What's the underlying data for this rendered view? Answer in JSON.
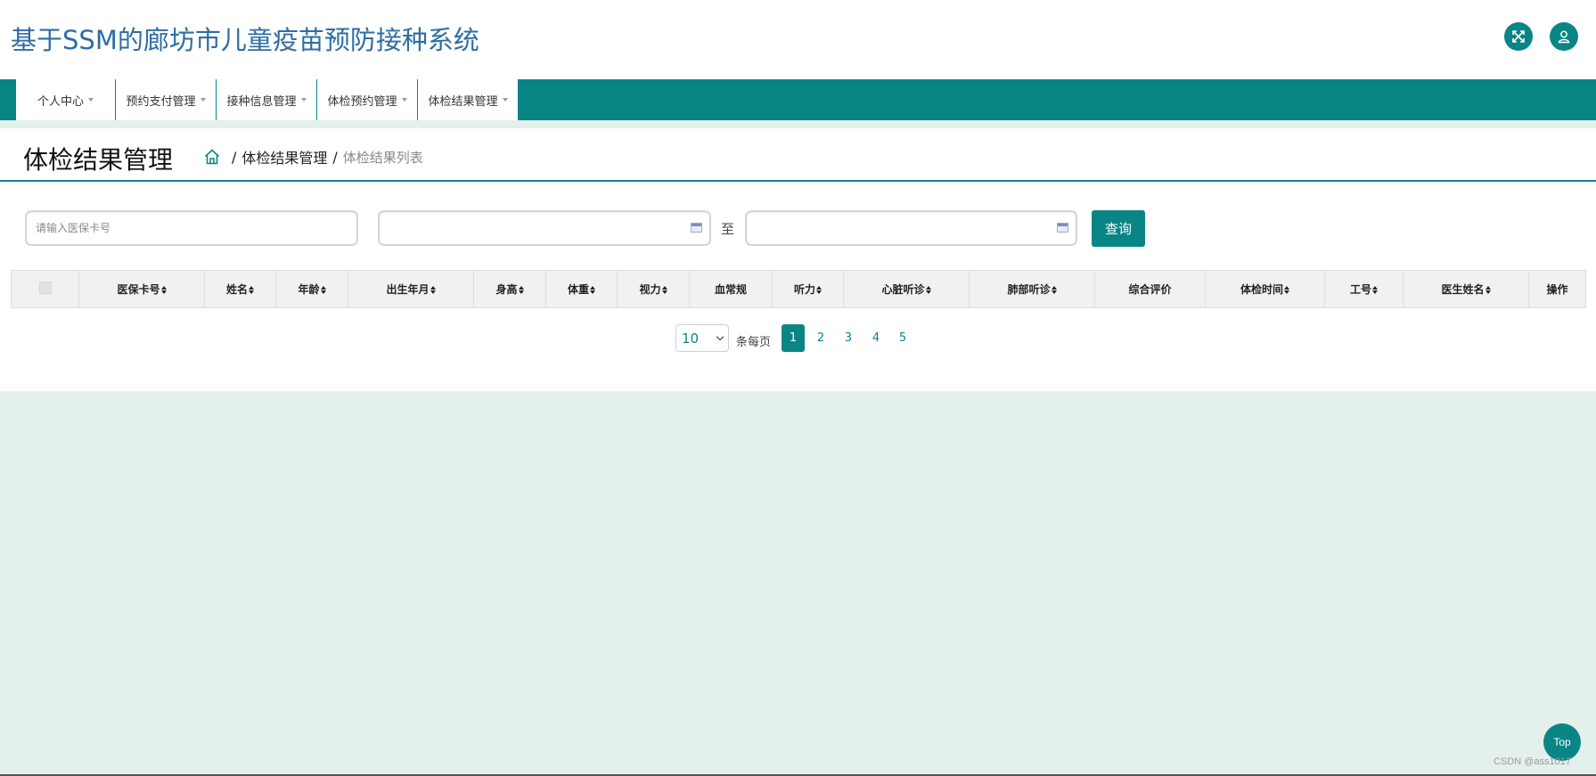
{
  "header": {
    "title": "基于SSM的廊坊市儿童疫苗预防接种系统",
    "fullscreen_icon": "fullscreen-icon",
    "user_icon": "user-icon"
  },
  "nav": {
    "items": [
      {
        "label": "个人中心"
      },
      {
        "label": "预约支付管理"
      },
      {
        "label": "接种信息管理"
      },
      {
        "label": "体检预约管理"
      },
      {
        "label": "体检结果管理"
      }
    ]
  },
  "page": {
    "title": "体检结果管理",
    "breadcrumb": {
      "sep": "/",
      "section": "体检结果管理",
      "current": "体检结果列表"
    }
  },
  "search": {
    "card_placeholder": "请输入医保卡号",
    "date_from": "",
    "date_to": "",
    "to_label": "至",
    "button_label": "查询"
  },
  "table": {
    "columns": [
      {
        "label": "医保卡号",
        "sortable": true
      },
      {
        "label": "姓名",
        "sortable": true
      },
      {
        "label": "年龄",
        "sortable": true
      },
      {
        "label": "出生年月",
        "sortable": true
      },
      {
        "label": "身高",
        "sortable": true
      },
      {
        "label": "体重",
        "sortable": true
      },
      {
        "label": "视力",
        "sortable": true
      },
      {
        "label": "血常规",
        "sortable": false
      },
      {
        "label": "听力",
        "sortable": true
      },
      {
        "label": "心脏听诊",
        "sortable": true
      },
      {
        "label": "肺部听诊",
        "sortable": true
      },
      {
        "label": "综合评价",
        "sortable": false
      },
      {
        "label": "体检时间",
        "sortable": true
      },
      {
        "label": "工号",
        "sortable": true
      },
      {
        "label": "医生姓名",
        "sortable": true
      },
      {
        "label": "操作",
        "sortable": false
      }
    ],
    "rows": []
  },
  "pagination": {
    "page_size": "10",
    "per_page_label": "条每页",
    "pages": [
      "1",
      "2",
      "3",
      "4",
      "5"
    ],
    "current": "1"
  },
  "floating": {
    "top_label": "Top"
  },
  "watermark": "CSDN @ass1017",
  "colors": {
    "primary": "#0a8585",
    "title_blue": "#2e6da4",
    "background": "#e4f0ec"
  }
}
